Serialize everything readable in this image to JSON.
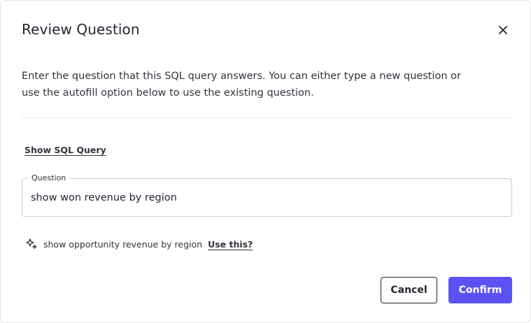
{
  "dialog": {
    "title": "Review Question",
    "close_icon": "close-icon",
    "description": "Enter the question that this SQL query answers. You can either type a new question or use the autofill option below to use the existing question.",
    "show_sql_link": "Show SQL Query",
    "question_field": {
      "label": "Question",
      "value": "show won revenue by region"
    },
    "suggestion": {
      "icon": "sparkle-icon",
      "text": "show opportunity revenue by region",
      "use_link": "Use this?"
    },
    "buttons": {
      "cancel_label": "Cancel",
      "confirm_label": "Confirm"
    },
    "colors": {
      "accent": "#5b52f5",
      "text": "#23262f",
      "border": "#c8ccd2"
    }
  }
}
